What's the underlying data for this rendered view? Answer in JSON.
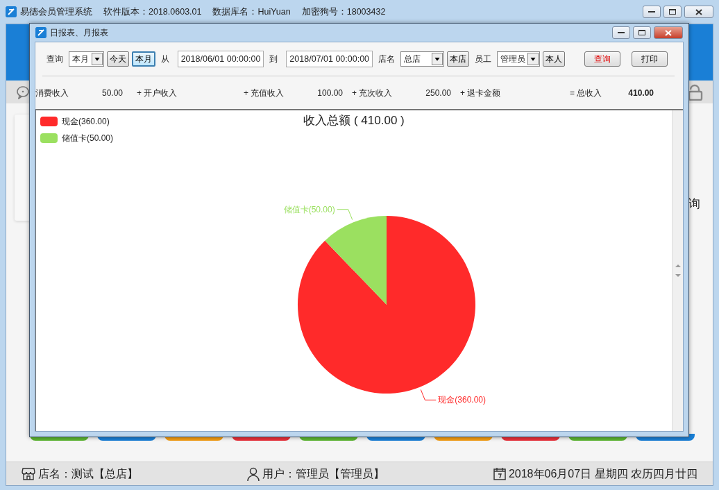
{
  "main_window": {
    "title_parts": [
      "易德会员管理系统",
      "软件版本：2018.0603.01",
      "数据库名：HuiYuan",
      "加密狗号：18003432"
    ],
    "partial_text": "询",
    "tiles": [
      {
        "color": "#5cb531"
      },
      {
        "color": "#1a7fd6"
      },
      {
        "color": "#f39c12"
      },
      {
        "color": "#e8303a"
      },
      {
        "color": "#5cb531"
      },
      {
        "color": "#1a7fd6"
      },
      {
        "color": "#f39c12"
      },
      {
        "color": "#e8303a"
      },
      {
        "color": "#5cb531"
      },
      {
        "color": "#1a7fd6"
      }
    ],
    "status_bar": {
      "store": "店名：测试【总店】",
      "user": "用户：管理员【管理员】",
      "date": "2018年06月07日 星期四 农历四月廿四"
    }
  },
  "dialog": {
    "title": "日报表、月报表",
    "toolbar": [
      {
        "kind": "label",
        "text": "查询"
      },
      {
        "kind": "select",
        "value": "本月"
      },
      {
        "kind": "button",
        "text": "今天",
        "selected": false
      },
      {
        "kind": "button",
        "text": "本月",
        "selected": true
      },
      {
        "kind": "label",
        "text": "从"
      },
      {
        "kind": "input",
        "value": "2018/06/01 00:00:00"
      },
      {
        "kind": "label",
        "text": "到"
      },
      {
        "kind": "input",
        "value": "2018/07/01 00:00:00"
      },
      {
        "kind": "label",
        "text": "店名"
      },
      {
        "kind": "select",
        "value": "总店"
      },
      {
        "kind": "button",
        "text": "本店",
        "selected": false
      },
      {
        "kind": "label",
        "text": "员工"
      },
      {
        "kind": "select",
        "value": "管理员"
      },
      {
        "kind": "button",
        "text": "本人",
        "selected": false
      },
      {
        "kind": "action",
        "text": "查询",
        "primary": true
      },
      {
        "kind": "action",
        "text": "打印",
        "primary": false
      }
    ],
    "summary": [
      {
        "label": "消费收入",
        "value": "50.00",
        "total": false
      },
      {
        "label": "+ 开户收入"
      },
      {
        "label": "+ 充值收入",
        "value": "100.00",
        "total": false
      },
      {
        "label": "+ 充次收入",
        "value": "250.00",
        "total": false
      },
      {
        "label": "+ 退卡金额"
      },
      {
        "label": "= 总收入",
        "value": "410.00",
        "total": true
      }
    ],
    "chart_data": {
      "type": "pie",
      "title": "收入总额 ( 410.00 )",
      "legend": "top-left",
      "categories": [
        "现金(360.00)",
        "储值卡(50.00)"
      ],
      "series": [
        {
          "colors": [
            "#ff2a2a",
            "#9be060"
          ],
          "values": [
            360,
            50
          ]
        }
      ],
      "value_labels": [
        "现金(360.00)",
        "储值卡(50.00)"
      ]
    }
  }
}
